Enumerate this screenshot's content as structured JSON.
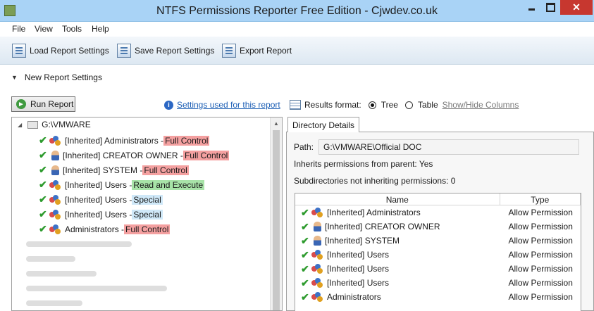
{
  "window": {
    "title": "NTFS Permissions Reporter Free Edition - Cjwdev.co.uk",
    "close_glyph": "✕"
  },
  "menu": [
    "File",
    "View",
    "Tools",
    "Help"
  ],
  "toolbar": {
    "load": "Load Report Settings",
    "save": "Save Report Settings",
    "export": "Export Report"
  },
  "settings_header": "New Report Settings",
  "run_button": "Run Report",
  "settings_link": "Settings used for this report",
  "results_format": {
    "label": "Results format:",
    "options": [
      {
        "label": "Tree",
        "selected": true
      },
      {
        "label": "Table",
        "selected": false
      }
    ],
    "show_hide": "Show/Hide Columns"
  },
  "tree": {
    "root": "G:\\VMWARE",
    "items": [
      {
        "icon": "group",
        "name": "[Inherited] Administrators - ",
        "perm": "Full Control",
        "perm_color": "#f4a0a0"
      },
      {
        "icon": "user",
        "name": "[Inherited] CREATOR OWNER - ",
        "perm": "Full Control",
        "perm_color": "#f4a0a0"
      },
      {
        "icon": "user",
        "name": "[Inherited] SYSTEM - ",
        "perm": "Full Control",
        "perm_color": "#f4a0a0"
      },
      {
        "icon": "group",
        "name": "[Inherited] Users - ",
        "perm": "Read and Execute",
        "perm_color": "#a8e3a8"
      },
      {
        "icon": "group",
        "name": "[Inherited] Users - ",
        "perm": "Special",
        "perm_color": "#cfe8f8"
      },
      {
        "icon": "group",
        "name": "[Inherited] Users - ",
        "perm": "Special",
        "perm_color": "#cfe8f8"
      },
      {
        "icon": "group",
        "name": "Administrators - ",
        "perm": "Full Control",
        "perm_color": "#f4a0a0"
      }
    ]
  },
  "details": {
    "tab": "Directory Details",
    "path_label": "Path:",
    "path": "G:\\VMWARE\\Official DOC",
    "inherits": "Inherits permissions from parent:  Yes",
    "subdirs": "Subdirectories not inheriting permissions:  0",
    "columns": [
      "Name",
      "Type"
    ],
    "rows": [
      {
        "icon": "group",
        "name": "[Inherited] Administrators",
        "type": "Allow Permission"
      },
      {
        "icon": "user",
        "name": "[Inherited] CREATOR OWNER",
        "type": "Allow Permission"
      },
      {
        "icon": "user",
        "name": "[Inherited] SYSTEM",
        "type": "Allow Permission"
      },
      {
        "icon": "group",
        "name": "[Inherited] Users",
        "type": "Allow Permission"
      },
      {
        "icon": "group",
        "name": "[Inherited] Users",
        "type": "Allow Permission"
      },
      {
        "icon": "group",
        "name": "[Inherited] Users",
        "type": "Allow Permission"
      },
      {
        "icon": "group",
        "name": "Administrators",
        "type": "Allow Permission"
      }
    ]
  }
}
